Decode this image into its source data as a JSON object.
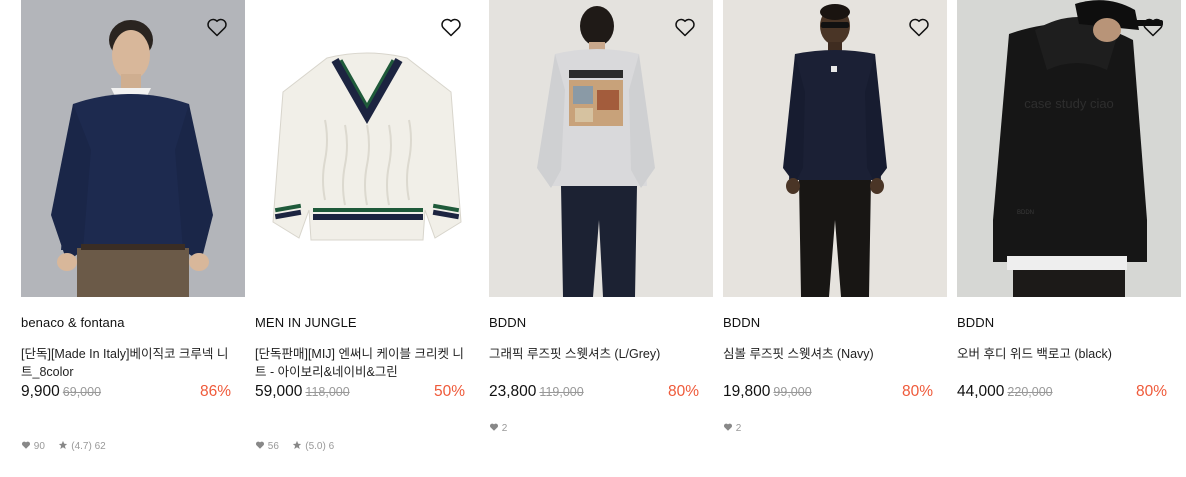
{
  "products": [
    {
      "brand": "benaco & fontana",
      "name": "[단독][Made In Italy]베이직코 크루넥 니트_8color",
      "price": "9,900",
      "original_price": "69,000",
      "discount": "86%",
      "likes": "90",
      "rating": "(4.7)",
      "reviews": "62",
      "image_bg": "#b3b5ba"
    },
    {
      "brand": "MEN IN JUNGLE",
      "name": "[단독판매][MIJ] 엔써니 케이블 크리켓 니트 - 아이보리&네이비&그린",
      "price": "59,000",
      "original_price": "118,000",
      "discount": "50%",
      "likes": "56",
      "rating": "(5.0)",
      "reviews": "6",
      "image_bg": "#ffffff"
    },
    {
      "brand": "BDDN",
      "name": "그래픽 루즈핏 스웻셔츠 (L/Grey)",
      "price": "23,800",
      "original_price": "119,000",
      "discount": "80%",
      "likes": "2",
      "image_bg": "#e4e2de"
    },
    {
      "brand": "BDDN",
      "name": "심볼 루즈핏 스웻셔츠 (Navy)",
      "price": "19,800",
      "original_price": "99,000",
      "discount": "80%",
      "likes": "2",
      "image_bg": "#e6e3de"
    },
    {
      "brand": "BDDN",
      "name": "오버 후디 위드 백로고 (black)",
      "price": "44,000",
      "original_price": "220,000",
      "discount": "80%",
      "image_bg": "#d6d7d4",
      "back_print": "case study ciao",
      "hem_print": "BDDN"
    }
  ],
  "icons": {
    "wishlist": "heart-outline-icon",
    "likes": "heart-icon",
    "rating": "star-icon"
  },
  "colors": {
    "discount": "#ef5a3a",
    "original_price": "#999999",
    "meta": "#999999"
  }
}
